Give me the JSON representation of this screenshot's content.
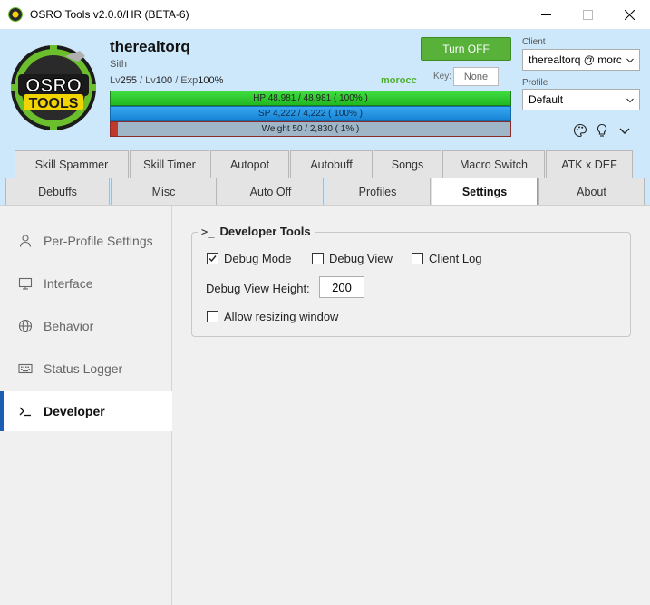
{
  "window": {
    "title": "OSRO Tools v2.0.0/HR (BETA-6)"
  },
  "header": {
    "logo_text": "OSRO TOOLS",
    "character_name": "therealtorq",
    "character_class": "Sith",
    "stats": {
      "lv_prefix": "Lv",
      "base_level": "255",
      "job_prefix": " / Lv",
      "job_level": "100",
      "exp_prefix": " / Exp",
      "exp_value": "100%"
    },
    "map_name": "morocc",
    "toggle_label": "Turn OFF",
    "key_label": "Key:",
    "key_value": "None",
    "bars": {
      "hp": {
        "text": "HP  48,981  /  48,981  ( 100% )",
        "fraction": 1.0,
        "color": "#2ec92e"
      },
      "sp": {
        "text": "SP  4,222  /  4,222  ( 100% )",
        "fraction": 1.0,
        "color": "#1e90e6"
      },
      "weight": {
        "text": "Weight  50  /  2,830  ( 1% )",
        "fraction": 0.018,
        "color": "#c0392b"
      }
    },
    "client_label": "Client",
    "client_value": "therealtorq @ morc",
    "profile_label": "Profile",
    "profile_value": "Default",
    "icons": [
      "palette-icon",
      "lightbulb-icon",
      "chevron-down-icon"
    ]
  },
  "tabs_row1": [
    "Skill Spammer",
    "Skill Timer",
    "Autopot",
    "Autobuff",
    "Songs",
    "Macro Switch",
    "ATK x DEF"
  ],
  "tabs_row2": [
    "Debuffs",
    "Misc",
    "Auto Off",
    "Profiles",
    "Settings",
    "About"
  ],
  "active_tab": "Settings",
  "sidebar": {
    "items": [
      {
        "label": "Per-Profile Settings",
        "icon": "person-icon"
      },
      {
        "label": "Interface",
        "icon": "monitor-icon"
      },
      {
        "label": "Behavior",
        "icon": "globe-icon"
      },
      {
        "label": "Status Logger",
        "icon": "keyboard-icon"
      },
      {
        "label": "Developer",
        "icon": "terminal-icon"
      }
    ],
    "active": "Developer"
  },
  "developer": {
    "group_title": "Developer Tools",
    "debug_mode": {
      "label": "Debug Mode",
      "checked": true
    },
    "debug_view": {
      "label": "Debug View",
      "checked": false
    },
    "client_log": {
      "label": "Client Log",
      "checked": false
    },
    "debug_view_height_label": "Debug View Height:",
    "debug_view_height_value": "200",
    "allow_resizing": {
      "label": "Allow resizing window",
      "checked": false
    }
  }
}
